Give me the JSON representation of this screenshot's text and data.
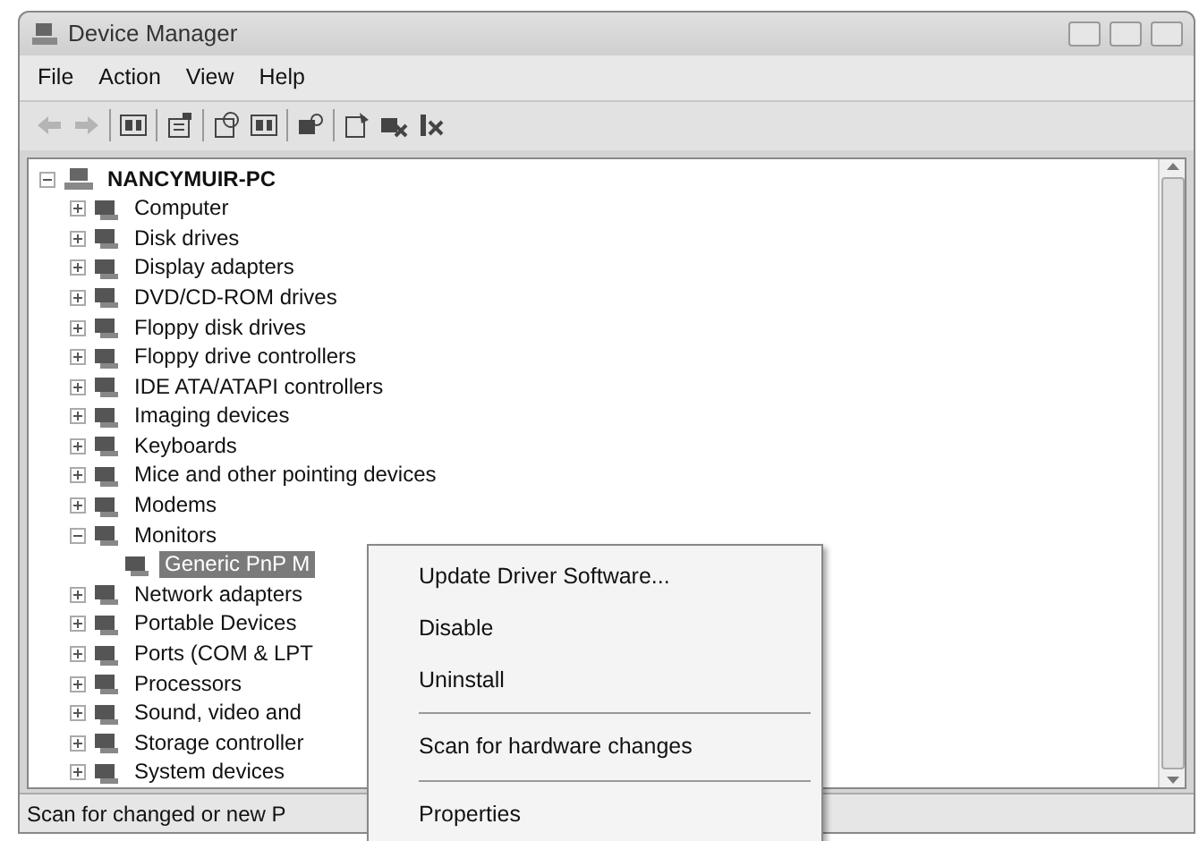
{
  "window": {
    "title": "Device Manager"
  },
  "menu": [
    "File",
    "Action",
    "View",
    "Help"
  ],
  "toolbar": [
    {
      "kind": "back",
      "disabled": true
    },
    {
      "kind": "forward",
      "disabled": true
    },
    {
      "kind": "separator"
    },
    {
      "kind": "pane",
      "disabled": false
    },
    {
      "kind": "separator"
    },
    {
      "kind": "properties",
      "disabled": false
    },
    {
      "kind": "separator"
    },
    {
      "kind": "help",
      "disabled": false
    },
    {
      "kind": "pane",
      "disabled": false
    },
    {
      "kind": "separator"
    },
    {
      "kind": "scan",
      "disabled": false
    },
    {
      "kind": "separator"
    },
    {
      "kind": "update",
      "disabled": false
    },
    {
      "kind": "disable",
      "disabled": false
    },
    {
      "kind": "uninstall",
      "disabled": false
    }
  ],
  "tree": {
    "label": "NANCYMUIR-PC",
    "expanded": true,
    "selected": false,
    "children": [
      {
        "label": "Computer",
        "expanded": false,
        "selected": false
      },
      {
        "label": "Disk drives",
        "expanded": false,
        "selected": false
      },
      {
        "label": "Display adapters",
        "expanded": false,
        "selected": false
      },
      {
        "label": "DVD/CD-ROM drives",
        "expanded": false,
        "selected": false
      },
      {
        "label": "Floppy disk drives",
        "expanded": false,
        "selected": false
      },
      {
        "label": "Floppy drive controllers",
        "expanded": false,
        "selected": false
      },
      {
        "label": "IDE ATA/ATAPI controllers",
        "expanded": false,
        "selected": false
      },
      {
        "label": "Imaging devices",
        "expanded": false,
        "selected": false
      },
      {
        "label": "Keyboards",
        "expanded": false,
        "selected": false
      },
      {
        "label": "Mice and other pointing devices",
        "expanded": false,
        "selected": false
      },
      {
        "label": "Modems",
        "expanded": false,
        "selected": false
      },
      {
        "label": "Monitors",
        "expanded": true,
        "selected": false,
        "children": [
          {
            "label": "Generic PnP M",
            "selected": true
          }
        ]
      },
      {
        "label": "Network adapters",
        "expanded": false,
        "selected": false
      },
      {
        "label": "Portable Devices",
        "expanded": false,
        "selected": false
      },
      {
        "label": "Ports (COM & LPT",
        "expanded": false,
        "selected": false
      },
      {
        "label": "Processors",
        "expanded": false,
        "selected": false
      },
      {
        "label": "Sound, video and",
        "expanded": false,
        "selected": false
      },
      {
        "label": "Storage controller",
        "expanded": false,
        "selected": false
      },
      {
        "label": "System devices",
        "expanded": false,
        "selected": false
      }
    ]
  },
  "context_menu": [
    {
      "kind": "item",
      "label": "Update Driver Software..."
    },
    {
      "kind": "item",
      "label": "Disable"
    },
    {
      "kind": "item",
      "label": "Uninstall"
    },
    {
      "kind": "separator"
    },
    {
      "kind": "item",
      "label": "Scan for hardware changes"
    },
    {
      "kind": "separator"
    },
    {
      "kind": "item",
      "label": "Properties"
    }
  ],
  "status_bar": "Scan for changed or new P"
}
